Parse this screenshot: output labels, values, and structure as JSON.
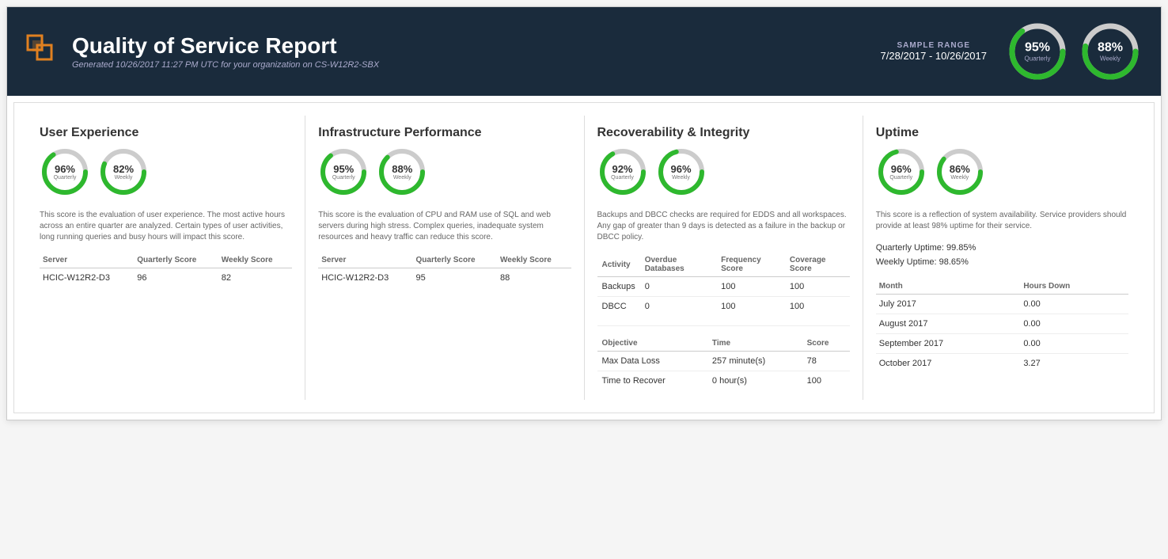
{
  "header": {
    "title": "Quality of Service Report",
    "subtitle": "Generated 10/26/2017 11:27 PM UTC for your organization on CS-W12R2-SBX",
    "sample_range_label": "SAMPLE RANGE",
    "sample_range_dates": "7/28/2017 - 10/26/2017",
    "overall_quarterly_percent": "95%",
    "overall_quarterly_label": "Quarterly",
    "overall_weekly_percent": "88%",
    "overall_weekly_label": "Weekly"
  },
  "sections": {
    "user_experience": {
      "title": "User Experience",
      "description": "This score is the evaluation of user experience. The most active hours across an entire quarter are analyzed. Certain types of user activities, long running queries and busy hours will impact this score.",
      "quarterly_percent": "96%",
      "quarterly_label": "Quarterly",
      "weekly_percent": "82%",
      "weekly_label": "Weekly",
      "table": {
        "col_server": "Server",
        "col_quarterly": "Quarterly Score",
        "col_weekly": "Weekly Score",
        "rows": [
          {
            "server": "HCIC-W12R2-D3",
            "quarterly": "96",
            "weekly": "82"
          }
        ]
      }
    },
    "infrastructure": {
      "title": "Infrastructure Performance",
      "description": "This score is the evaluation of CPU and RAM use of SQL and web servers during high stress. Complex queries, inadequate system resources and heavy traffic can reduce this score.",
      "quarterly_percent": "95%",
      "quarterly_label": "Quarterly",
      "weekly_percent": "88%",
      "weekly_label": "Weekly",
      "table": {
        "col_server": "Server",
        "col_quarterly": "Quarterly Score",
        "col_weekly": "Weekly Score",
        "rows": [
          {
            "server": "HCIC-W12R2-D3",
            "quarterly": "95",
            "weekly": "88"
          }
        ]
      }
    },
    "recoverability": {
      "title": "Recoverability & Integrity",
      "description": "Backups and DBCC checks are required for EDDS and all workspaces. Any gap of greater than 9 days is detected as a failure in the backup or DBCC policy.",
      "quarterly_percent": "92%",
      "quarterly_label": "Quarterly",
      "weekly_percent": "96%",
      "weekly_label": "Weekly",
      "activity_table": {
        "col_activity": "Activity",
        "col_overdue": "Overdue Databases",
        "col_frequency": "Frequency Score",
        "col_coverage": "Coverage Score",
        "rows": [
          {
            "activity": "Backups",
            "overdue": "0",
            "frequency": "100",
            "coverage": "100"
          },
          {
            "activity": "DBCC",
            "overdue": "0",
            "frequency": "100",
            "coverage": "100"
          }
        ]
      },
      "objective_table": {
        "col_objective": "Objective",
        "col_time": "Time",
        "col_score": "Score",
        "rows": [
          {
            "objective": "Max Data Loss",
            "time": "257 minute(s)",
            "score": "78"
          },
          {
            "objective": "Time to Recover",
            "time": "0 hour(s)",
            "score": "100"
          }
        ]
      }
    },
    "uptime": {
      "title": "Uptime",
      "description": "This score is a reflection of system availability. Service providers should provide at least 98% uptime for their service.",
      "quarterly_percent": "96%",
      "quarterly_label": "Quarterly",
      "weekly_percent": "86%",
      "weekly_label": "Weekly",
      "quarterly_uptime": "Quarterly Uptime: 99.85%",
      "weekly_uptime": "Weekly Uptime: 98.65%",
      "table": {
        "col_month": "Month",
        "col_hours": "Hours Down",
        "rows": [
          {
            "month": "July 2017",
            "hours": "0.00"
          },
          {
            "month": "August 2017",
            "hours": "0.00"
          },
          {
            "month": "September 2017",
            "hours": "0.00"
          },
          {
            "month": "October 2017",
            "hours": "3.27"
          }
        ]
      }
    }
  },
  "colors": {
    "green": "#2eb82e",
    "light_gray": "#cccccc",
    "dark_bg": "#1a2b3c"
  }
}
